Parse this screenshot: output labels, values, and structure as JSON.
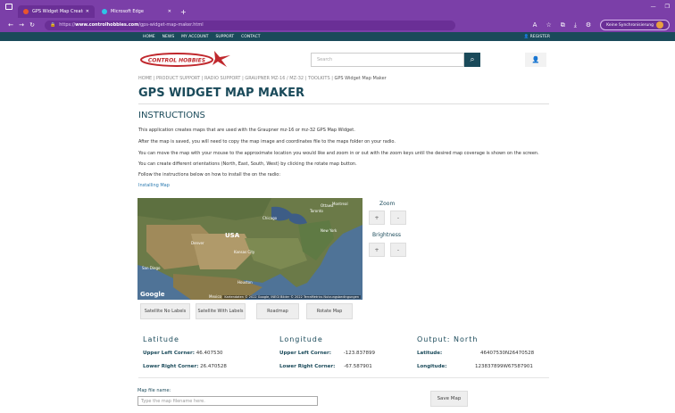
{
  "browser": {
    "tabs": [
      {
        "label": "GPS Widget Map Creator for Gra",
        "active": true
      },
      {
        "label": "Microsoft Edge",
        "active": false
      }
    ],
    "url_domain": "www.controlhobbies.com",
    "url_path": "/gps-widget-map-maker.html",
    "url_scheme": "https://",
    "sync_label": "Keine Synchronisierung",
    "accent": "#7b3fa8"
  },
  "sitenav": {
    "links": [
      "HOME",
      "NEWS",
      "MY ACCOUNT",
      "SUPPORT",
      "CONTACT"
    ],
    "register": "REGISTER"
  },
  "header": {
    "logo_text": "CONTROL HOBBIES",
    "search_placeholder": "Search"
  },
  "breadcrumb": {
    "items": [
      "HOME",
      "PRODUCT SUPPORT",
      "RADIO SUPPORT",
      "GRAUPNER MZ-16 / MZ-32",
      "TOOLKITS"
    ],
    "current": "GPS Widget Map Maker"
  },
  "page": {
    "title": "GPS WIDGET MAP MAKER",
    "instructions_title": "INSTRUCTIONS",
    "paragraphs": [
      "This application creates maps that are used with the Graupner mz-16 or mz-32 GPS Map Widget.",
      "After the map is saved, you will need to copy the map image and coordinates file to the maps folder on your radio.",
      "You can move the map with your mouse to the approximate location you would like and zoom in or out with the zoom keys until the desired map coverage is shown on the screen.",
      "You can create different orientations (North, East, South, West) by clicking the rotate map button.",
      "Follow the instructions below on how to install the on the radio:"
    ],
    "install_link": "Installing Map"
  },
  "map": {
    "credit": "Kartendaten © 2022 Google, INEGI Bilder © 2022 TerraMetrics   Nutzungsbedingungen",
    "google": "Google",
    "usa_label": "USA",
    "mexico_label": "Mexico",
    "city_labels": [
      "Chicago",
      "Toronto",
      "Montreal",
      "San Diego",
      "Houston",
      "Denver",
      "Kansas City",
      "New York",
      "Ottawa"
    ]
  },
  "controls": {
    "zoom_label": "Zoom",
    "brightness_label": "Brightness",
    "plus": "+",
    "minus": "-"
  },
  "map_buttons": {
    "satellite_no_labels": "Satellite No Labels",
    "satellite_with_labels": "Satellite With Labels",
    "roadmap": "Roadmap",
    "rotate": "Rotate Map"
  },
  "coords": {
    "latitude_head": "Latitude",
    "longitude_head": "Longitude",
    "output_head": "Output: North",
    "upper_left_label": "Upper Left Corner:",
    "lower_right_label": "Lower Right Corner:",
    "lat_ul": "46.407530",
    "lat_lr": "26.470528",
    "lon_ul": "-123.837899",
    "lon_lr": "-67.587901",
    "out_lat_label": "Latitude:",
    "out_lon_label": "Longitude:",
    "out_lat": "46407530N26470528",
    "out_lon": "123837899W67587901"
  },
  "save": {
    "file_label": "Map file name:",
    "file_placeholder": "Type the map filename here.",
    "save_button": "Save Map"
  }
}
